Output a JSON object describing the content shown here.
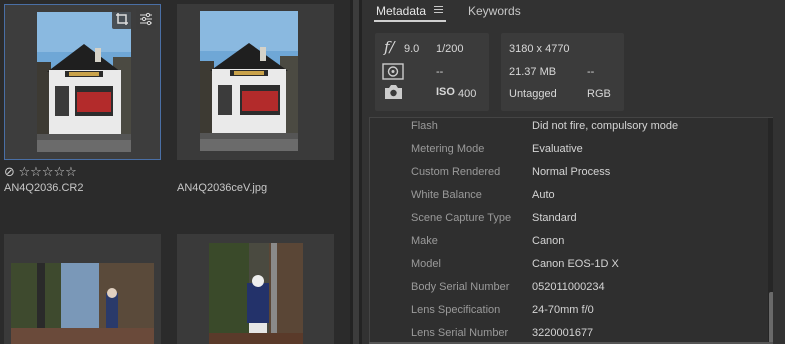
{
  "grid": {
    "items": [
      {
        "filename": "AN4Q2036.CR2",
        "rating": "☆☆☆☆☆",
        "reject": "⊘"
      },
      {
        "filename": "AN4Q2036ceV.jpg"
      },
      {},
      {}
    ]
  },
  "panel": {
    "tabs": [
      {
        "label": "Metadata"
      },
      {
        "label": "Keywords"
      }
    ],
    "summary": {
      "aperture": "9.0",
      "aperture_symbol": "f/",
      "shutter": "1/200",
      "metering": "--",
      "iso_label": "ISO",
      "iso": "400",
      "dimensions": "3180 x 4770",
      "filesize": "21.37 MB",
      "color_profile": "--",
      "label_status": "Untagged",
      "color_mode": "RGB"
    },
    "rows": [
      {
        "key": "Flash",
        "value": "Did not fire, compulsory mode"
      },
      {
        "key": "Metering Mode",
        "value": "Evaluative"
      },
      {
        "key": "Custom Rendered",
        "value": "Normal Process"
      },
      {
        "key": "White Balance",
        "value": "Auto"
      },
      {
        "key": "Scene Capture Type",
        "value": "Standard"
      },
      {
        "key": "Make",
        "value": "Canon"
      },
      {
        "key": "Model",
        "value": "Canon EOS-1D X"
      },
      {
        "key": "Body Serial Number",
        "value": "052011000234"
      },
      {
        "key": "Lens Specification",
        "value": "24-70mm f/0"
      },
      {
        "key": "Lens Serial Number",
        "value": "3220001677"
      }
    ]
  }
}
